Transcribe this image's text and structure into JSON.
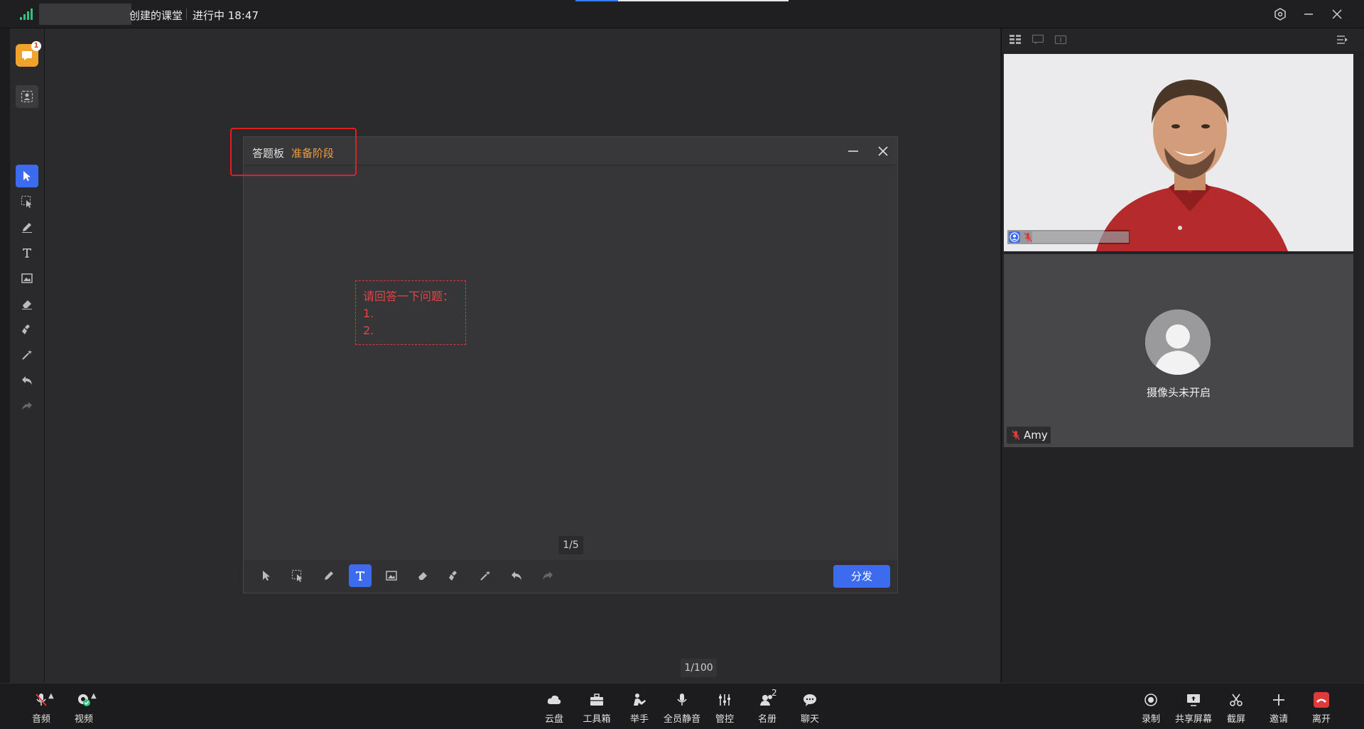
{
  "titlebar": {
    "title": "创建的课堂",
    "status": "进行中 18:47"
  },
  "left_toolbar": {
    "notice_badge": "1",
    "tools": [
      "pointer-icon",
      "select-icon",
      "pen-icon",
      "text-icon",
      "image-icon",
      "eraser-icon",
      "clear-icon",
      "laser-icon",
      "undo-icon",
      "redo-icon"
    ]
  },
  "main": {
    "page_indicator": "1/100"
  },
  "board": {
    "title": "答题板",
    "stage": "准备阶段",
    "question_line1": "请回答一下问题：",
    "question_line2": "1.",
    "question_line3": "2.",
    "page": "1/5",
    "distribute_label": "分发"
  },
  "right_panel": {
    "camera_off_text": "摄像头未开启",
    "participant2_name": "Amy"
  },
  "bottom_bar": {
    "audio_label": "音频",
    "video_label": "视频",
    "cloud_label": "云盘",
    "toolbox_label": "工具箱",
    "raise_hand_label": "举手",
    "mute_all_label": "全员静音",
    "control_label": "管控",
    "roster_label": "名册",
    "roster_count": "2",
    "chat_label": "聊天",
    "record_label": "录制",
    "share_label": "共享屏幕",
    "screenshot_label": "截屏",
    "invite_label": "邀请",
    "leave_label": "离开"
  },
  "colors": {
    "accent": "#3d6bf0",
    "stage": "#f39b3c",
    "question_text": "#e04646",
    "highlight": "#e02020",
    "leave": "#e03a3a"
  }
}
